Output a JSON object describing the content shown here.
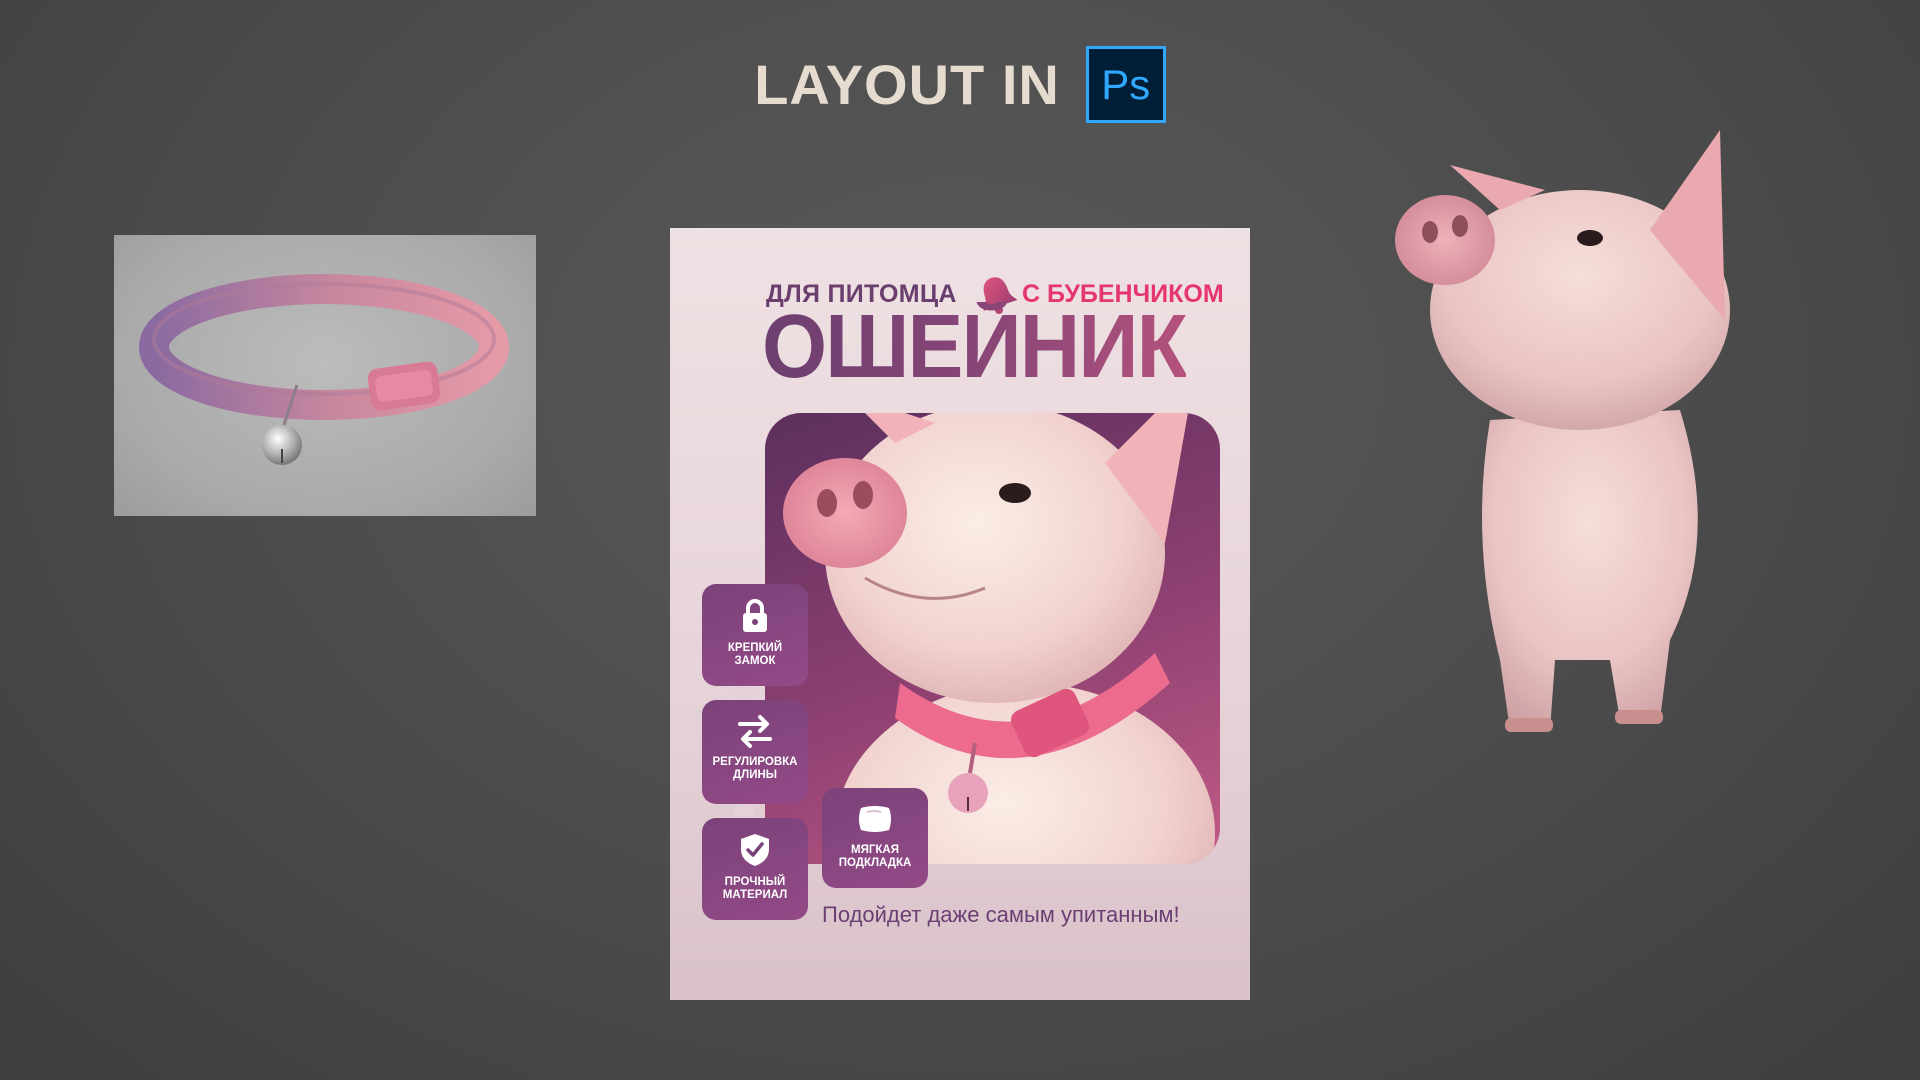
{
  "header": {
    "title": "LAYOUT IN",
    "ps_logo_text": "Ps"
  },
  "poster": {
    "subtitle_left": "ДЛЯ ПИТОМЦА",
    "subtitle_right": "С БУБЕНЧИКОМ",
    "headline": "ОШЕЙНИК",
    "features": [
      {
        "label": "КРЕПКИЙ\nЗАМОК",
        "icon": "lock-icon"
      },
      {
        "label": "РЕГУЛИРОВКА\nДЛИНЫ",
        "icon": "swap-arrows-icon"
      },
      {
        "label": "ПРОЧНЫЙ\nМАТЕРИАЛ",
        "icon": "shield-check-icon"
      },
      {
        "label": "МЯГКАЯ\nПОДКЛАДКА",
        "icon": "pillow-icon"
      }
    ],
    "tagline": "Подойдет даже самым упитанным!"
  },
  "colors": {
    "background": "#4b4b4b",
    "title_text": "#e5dccf",
    "ps_blue": "#31a8ff",
    "ps_dark": "#001e36",
    "brand_purple": "#6a3f6e",
    "accent_pink": "#e6366f",
    "poster_bg": "#ecdde0"
  }
}
